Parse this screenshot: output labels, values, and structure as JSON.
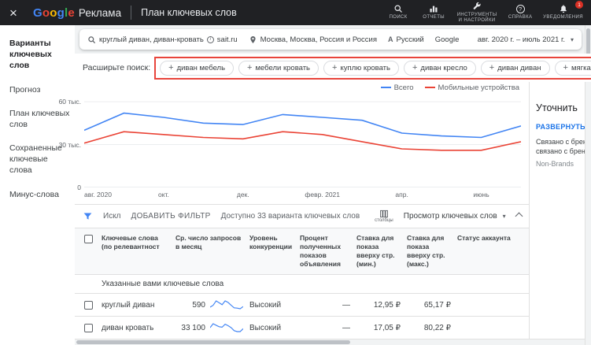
{
  "colors": {
    "topbar_bg": "#202124",
    "accent_blue": "#1a73e8",
    "annotation_red": "#e8453c",
    "chart_total": "#4285f4",
    "chart_mobile": "#ea4335"
  },
  "icons": {
    "close": "×",
    "plus": "+",
    "caret_down": "▾",
    "help": "?",
    "info": "i",
    "lang": "A"
  },
  "topbar": {
    "brand_letters": [
      "G",
      "o",
      "o",
      "g",
      "l",
      "e"
    ],
    "brand_suffix": "Реклама",
    "title": "План ключевых слов",
    "actions": [
      {
        "label": "ПОИСК"
      },
      {
        "label": "ОТЧЕТЫ"
      },
      {
        "label": "ИНСТРУМЕНТЫ И НАСТРОЙКИ"
      },
      {
        "label": "СПРАВКА"
      },
      {
        "label": "УВЕДОМЛЕНИЯ",
        "badge": "1"
      }
    ]
  },
  "sidebar": {
    "items": [
      {
        "label": "Варианты ключевых слов",
        "active": true
      },
      {
        "label": "Прогноз",
        "active": false
      },
      {
        "label": "План ключевых слов",
        "active": false
      },
      {
        "label": "Сохраненные ключевые слова",
        "active": false
      },
      {
        "label": "Минус-слова",
        "active": false
      }
    ]
  },
  "searchbar": {
    "query": "круглый диван, диван-кровать",
    "site": "sait.ru",
    "location": "Москва, Москва, Россия и Россия",
    "language": "Русский",
    "network": "Google",
    "date_range": "авг. 2020 г. – июль 2021 г."
  },
  "expand": {
    "label": "Расширьте поиск:",
    "chips": [
      "диван мебель",
      "мебели кровать",
      "куплю кровать",
      "диван кресло",
      "диван диван",
      "мягкая мебель кровать"
    ]
  },
  "chart_data": {
    "type": "line",
    "title": "",
    "x": [
      "авг. 2020",
      "сент.",
      "окт.",
      "нояб.",
      "дек.",
      "янв. 2021",
      "февр. 2021",
      "март",
      "апр.",
      "май",
      "июнь",
      "июль"
    ],
    "x_tick_labels": [
      {
        "index": 0,
        "label": "авг. 2020"
      },
      {
        "index": 2,
        "label": "окт."
      },
      {
        "index": 4,
        "label": "дек."
      },
      {
        "index": 6,
        "label": "февр. 2021"
      },
      {
        "index": 8,
        "label": "апр."
      },
      {
        "index": 10,
        "label": "июнь"
      }
    ],
    "series": [
      {
        "name": "Всего",
        "color": "#4285f4",
        "values": [
          40000,
          52000,
          49000,
          45000,
          44000,
          51000,
          49000,
          47000,
          38000,
          36000,
          35000,
          43000
        ]
      },
      {
        "name": "Мобильные устройства",
        "color": "#ea4335",
        "values": [
          31000,
          39000,
          37000,
          35000,
          34000,
          39000,
          37000,
          32000,
          27000,
          26000,
          26000,
          32000
        ]
      }
    ],
    "ylim": [
      0,
      65000
    ],
    "y_ticks": [
      {
        "value": 0,
        "label": "0"
      },
      {
        "value": 30000,
        "label": "30 тыс."
      },
      {
        "value": 60000,
        "label": "60 тыс."
      }
    ],
    "grid": true,
    "legend_position": "top-right"
  },
  "filter_bar": {
    "filter_text": "Искл",
    "add_filter": "ДОБАВИТЬ ФИЛЬТР",
    "available": "Доступно 33 варианта ключевых слов",
    "columns_label": "столбцы",
    "view_selector": "Просмотр ключевых слов"
  },
  "refine_panel": {
    "title": "Уточнить",
    "expand_all": "РАЗВЕРНУТЬ ВСЕ",
    "option_line1": "Связано с брендом",
    "option_line2": "связано с брендом",
    "group_label": "Non-Brands"
  },
  "table": {
    "columns": [
      "Ключевые слова (по релевантност",
      "Ср. число запросов в месяц",
      "Уровень конкуренции",
      "Процент полученных показов объявления",
      "Ставка для показа вверху стр. (мин.)",
      "Ставка для показа вверху стр. (макс.)",
      "Статус аккаунта"
    ],
    "section_label": "Указанные вами ключевые слова",
    "rows": [
      {
        "keyword": "круглый диван",
        "avg_monthly_searches": "590",
        "trend": [
          500,
          560,
          700,
          640,
          580,
          700,
          650,
          560,
          480,
          470,
          450,
          520
        ],
        "competition": "Высокий",
        "ad_impression_share": "—",
        "top_bid_low": "12,95 ₽",
        "top_bid_high": "65,17 ₽",
        "account_status": ""
      },
      {
        "keyword": "диван кровать",
        "avg_monthly_searches": "33 100",
        "trend": [
          36,
          44,
          41,
          38,
          37,
          43,
          40,
          36,
          30,
          28,
          28,
          34
        ],
        "competition": "Высокий",
        "ad_impression_share": "—",
        "top_bid_low": "17,05 ₽",
        "top_bid_high": "80,22 ₽",
        "account_status": ""
      }
    ]
  }
}
